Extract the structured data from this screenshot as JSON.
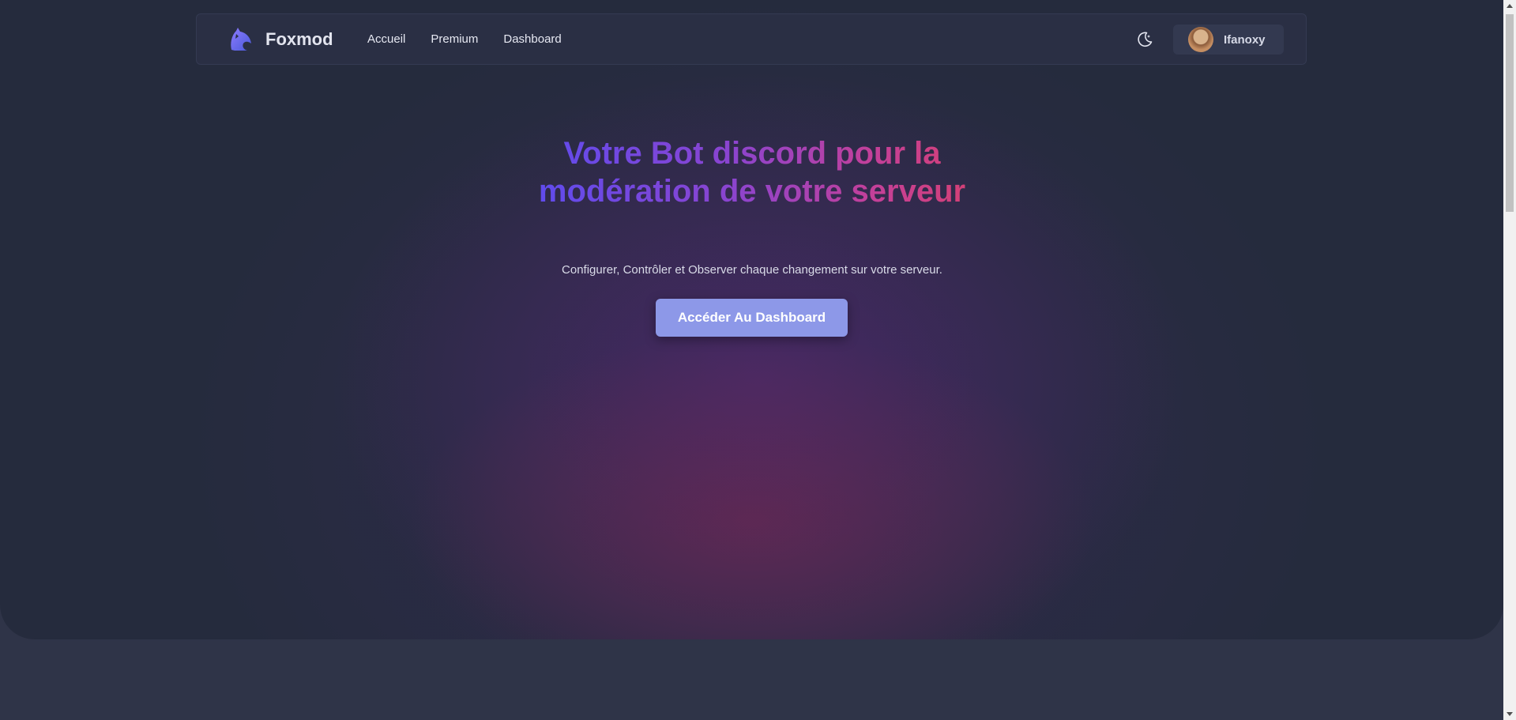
{
  "navbar": {
    "brand_name": "Foxmod",
    "brand_logo_icon": "fox-logo-icon",
    "links": [
      {
        "label": "Accueil"
      },
      {
        "label": "Premium"
      },
      {
        "label": "Dashboard"
      }
    ],
    "theme_toggle_icon": "moon-icon",
    "user": {
      "name": "Ifanoxy",
      "avatar_icon": "user-avatar"
    }
  },
  "hero": {
    "headline": "Votre Bot discord pour la modération de votre serveur",
    "subtitle": "Configurer, Contrôler et Observer chaque changement sur votre serveur.",
    "cta_label": "Accéder Au Dashboard"
  },
  "colors": {
    "page_background": "#2f3448",
    "hero_background": "#252b3d",
    "navbar_background": "#2a2f44",
    "cta_background": "#8d98e8",
    "headline_gradient_start": "#5b4cf0",
    "headline_gradient_end": "#d7406f"
  }
}
